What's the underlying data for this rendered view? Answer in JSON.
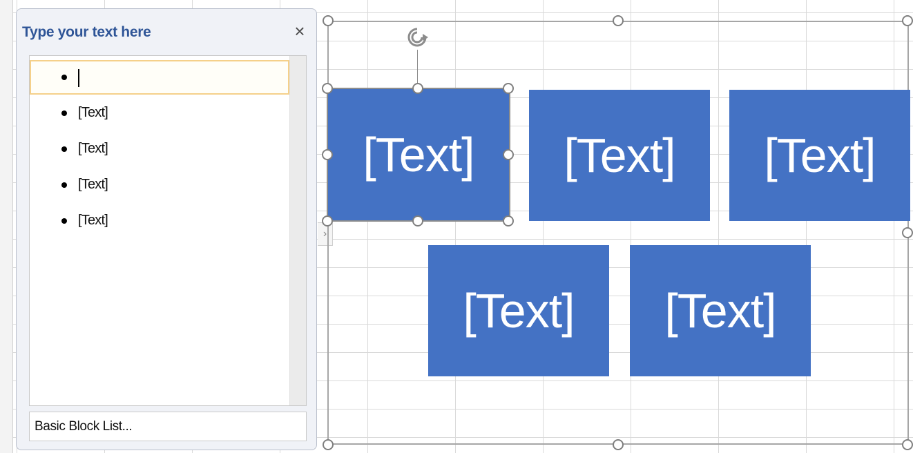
{
  "text_pane": {
    "title": "Type your text here",
    "close_label": "×",
    "items": [
      {
        "text": ""
      },
      {
        "text": "[Text]"
      },
      {
        "text": "[Text]"
      },
      {
        "text": "[Text]"
      },
      {
        "text": "[Text]"
      }
    ],
    "footer_label": "Basic Block List...",
    "expand_label": "›"
  },
  "smartart": {
    "layout": "Basic Block List",
    "blocks": [
      {
        "text": "[Text]",
        "selected": true
      },
      {
        "text": "[Text]",
        "selected": false
      },
      {
        "text": "[Text]",
        "selected": false
      },
      {
        "text": "[Text]",
        "selected": false
      },
      {
        "text": "[Text]",
        "selected": false
      }
    ]
  },
  "colors": {
    "block_fill": "#4472c4",
    "pane_title": "#2f5597",
    "active_row_border": "#f5d08a"
  },
  "icons": {
    "close": "close-icon",
    "rotate": "rotate-icon",
    "bullet": "bullet-icon",
    "expand": "chevron-right-icon"
  }
}
